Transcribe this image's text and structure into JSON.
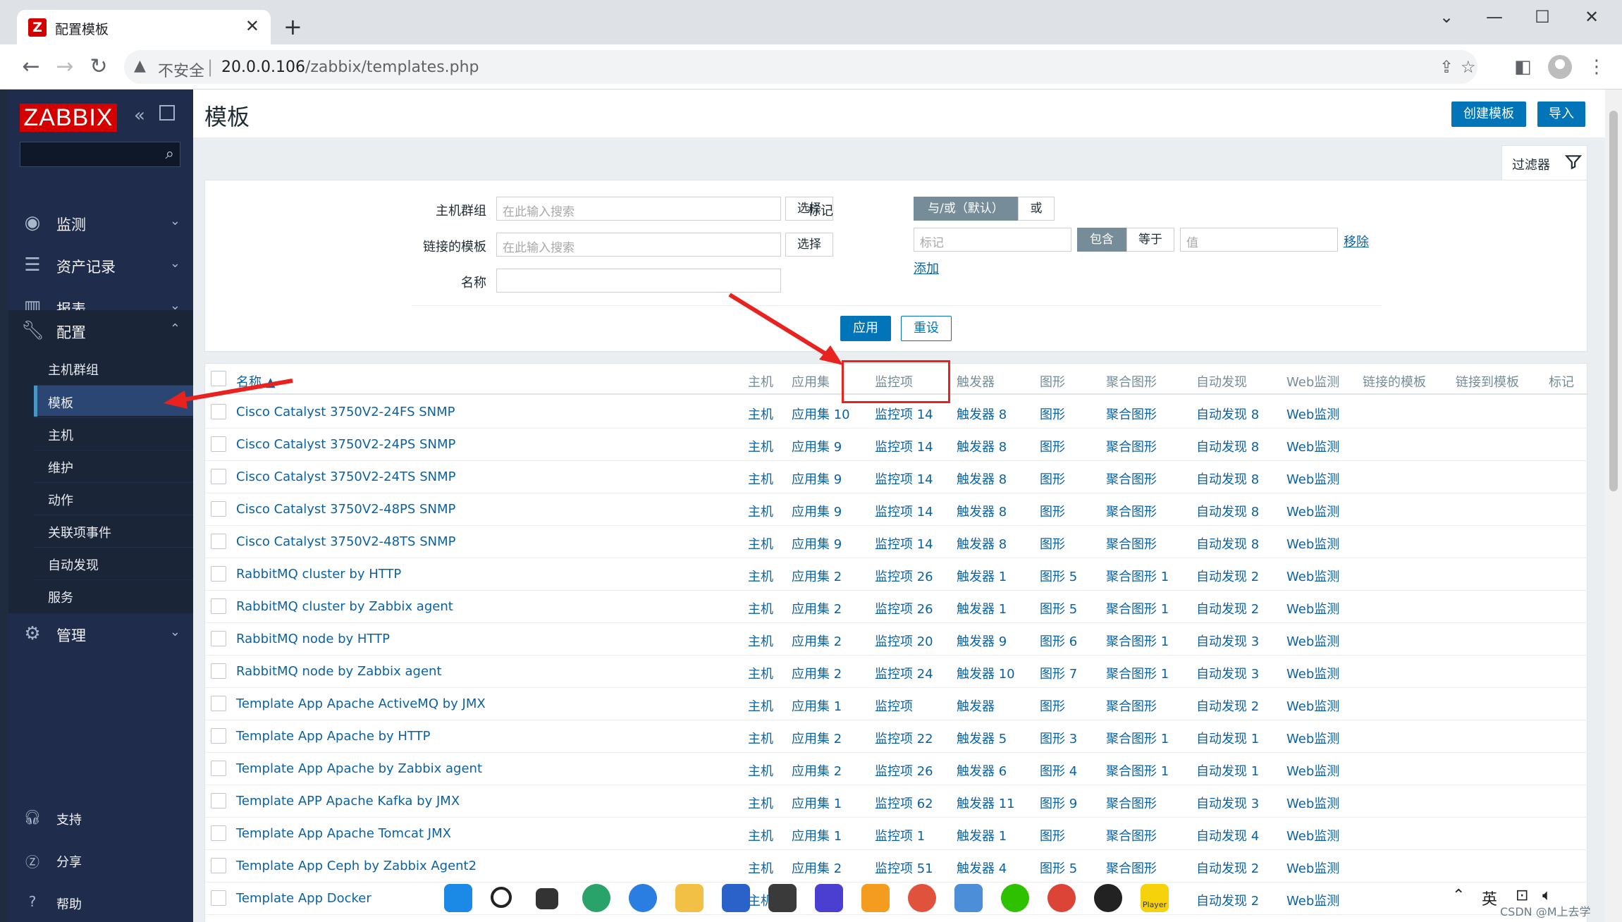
{
  "browser": {
    "tab_title": "配置模板",
    "tab_favicon": "Z",
    "insecure_label": "不安全",
    "url_host": "20.0.0.106",
    "url_path": "/zabbix/templates.php"
  },
  "sidebar": {
    "logo": "ZABBIX",
    "menu": [
      {
        "label": "监测",
        "icon": "eye-icon"
      },
      {
        "label": "资产记录",
        "icon": "list-icon"
      },
      {
        "label": "报表",
        "icon": "chart-icon"
      },
      {
        "label": "配置",
        "icon": "wrench-icon"
      },
      {
        "label": "管理",
        "icon": "gear-icon"
      }
    ],
    "config_submenu": [
      "主机群组",
      "模板",
      "主机",
      "维护",
      "动作",
      "关联项事件",
      "自动发现",
      "服务"
    ],
    "active_submenu": "模板",
    "bottom": [
      {
        "label": "支持",
        "icon": "headset-icon"
      },
      {
        "label": "分享",
        "icon": "share-icon"
      },
      {
        "label": "帮助",
        "icon": "help-icon"
      }
    ]
  },
  "page": {
    "title": "模板",
    "create_button": "创建模板",
    "import_button": "导入",
    "filter_tab": "过滤器"
  },
  "filter": {
    "host_group_label": "主机群组",
    "host_group_placeholder": "在此输入搜索",
    "linked_templates_label": "链接的模板",
    "linked_templates_placeholder": "在此输入搜索",
    "name_label": "名称",
    "name_value": "",
    "select_button": "选择",
    "tags_label": "标记",
    "tag_and_or": "与/或（默认）",
    "tag_or": "或",
    "tag_placeholder": "标记",
    "contains": "包含",
    "equals": "等于",
    "value_placeholder": "值",
    "remove_link": "移除",
    "add_link": "添加",
    "apply_button": "应用",
    "reset_button": "重设"
  },
  "table": {
    "headers": {
      "name": "名称 ▲",
      "hosts": "主机",
      "applications": "应用集",
      "items": "监控项",
      "triggers": "触发器",
      "graphs": "图形",
      "screens": "聚合图形",
      "discovery": "自动发现",
      "web": "Web监测",
      "linked_templates": "链接的模板",
      "linked_to": "链接到模板",
      "tags": "标记"
    },
    "rows": [
      {
        "name": "Cisco Catalyst 3750V2-24FS SNMP",
        "hosts": "主机",
        "apps": "应用集 10",
        "items": "监控项 14",
        "triggers": "触发器 8",
        "graphs": "图形",
        "screens": "聚合图形",
        "discovery": "自动发现 8",
        "web": "Web监测"
      },
      {
        "name": "Cisco Catalyst 3750V2-24PS SNMP",
        "hosts": "主机",
        "apps": "应用集 9",
        "items": "监控项 14",
        "triggers": "触发器 8",
        "graphs": "图形",
        "screens": "聚合图形",
        "discovery": "自动发现 8",
        "web": "Web监测"
      },
      {
        "name": "Cisco Catalyst 3750V2-24TS SNMP",
        "hosts": "主机",
        "apps": "应用集 9",
        "items": "监控项 14",
        "triggers": "触发器 8",
        "graphs": "图形",
        "screens": "聚合图形",
        "discovery": "自动发现 8",
        "web": "Web监测"
      },
      {
        "name": "Cisco Catalyst 3750V2-48PS SNMP",
        "hosts": "主机",
        "apps": "应用集 9",
        "items": "监控项 14",
        "triggers": "触发器 8",
        "graphs": "图形",
        "screens": "聚合图形",
        "discovery": "自动发现 8",
        "web": "Web监测"
      },
      {
        "name": "Cisco Catalyst 3750V2-48TS SNMP",
        "hosts": "主机",
        "apps": "应用集 9",
        "items": "监控项 14",
        "triggers": "触发器 8",
        "graphs": "图形",
        "screens": "聚合图形",
        "discovery": "自动发现 8",
        "web": "Web监测"
      },
      {
        "name": "RabbitMQ cluster by HTTP",
        "hosts": "主机",
        "apps": "应用集 2",
        "items": "监控项 26",
        "triggers": "触发器 1",
        "graphs": "图形 5",
        "screens": "聚合图形 1",
        "discovery": "自动发现 2",
        "web": "Web监测"
      },
      {
        "name": "RabbitMQ cluster by Zabbix agent",
        "hosts": "主机",
        "apps": "应用集 2",
        "items": "监控项 26",
        "triggers": "触发器 1",
        "graphs": "图形 5",
        "screens": "聚合图形 1",
        "discovery": "自动发现 2",
        "web": "Web监测"
      },
      {
        "name": "RabbitMQ node by HTTP",
        "hosts": "主机",
        "apps": "应用集 2",
        "items": "监控项 20",
        "triggers": "触发器 9",
        "graphs": "图形 6",
        "screens": "聚合图形 1",
        "discovery": "自动发现 3",
        "web": "Web监测"
      },
      {
        "name": "RabbitMQ node by Zabbix agent",
        "hosts": "主机",
        "apps": "应用集 2",
        "items": "监控项 24",
        "triggers": "触发器 10",
        "graphs": "图形 7",
        "screens": "聚合图形 1",
        "discovery": "自动发现 3",
        "web": "Web监测"
      },
      {
        "name": "Template App Apache ActiveMQ by JMX",
        "hosts": "主机",
        "apps": "应用集 1",
        "items": "监控项",
        "triggers": "触发器",
        "graphs": "图形",
        "screens": "聚合图形",
        "discovery": "自动发现 2",
        "web": "Web监测"
      },
      {
        "name": "Template App Apache by HTTP",
        "hosts": "主机",
        "apps": "应用集 2",
        "items": "监控项 22",
        "triggers": "触发器 5",
        "graphs": "图形 3",
        "screens": "聚合图形 1",
        "discovery": "自动发现 1",
        "web": "Web监测"
      },
      {
        "name": "Template App Apache by Zabbix agent",
        "hosts": "主机",
        "apps": "应用集 2",
        "items": "监控项 26",
        "triggers": "触发器 6",
        "graphs": "图形 4",
        "screens": "聚合图形 1",
        "discovery": "自动发现 1",
        "web": "Web监测"
      },
      {
        "name": "Template APP Apache Kafka by JMX",
        "hosts": "主机",
        "apps": "应用集 1",
        "items": "监控项 62",
        "triggers": "触发器 11",
        "graphs": "图形 9",
        "screens": "聚合图形",
        "discovery": "自动发现 3",
        "web": "Web监测"
      },
      {
        "name": "Template App Apache Tomcat JMX",
        "hosts": "主机",
        "apps": "应用集 1",
        "items": "监控项 1",
        "triggers": "触发器 1",
        "graphs": "图形",
        "screens": "聚合图形",
        "discovery": "自动发现 4",
        "web": "Web监测"
      },
      {
        "name": "Template App Ceph by Zabbix Agent2",
        "hosts": "主机",
        "apps": "应用集 2",
        "items": "监控项 51",
        "triggers": "触发器 4",
        "graphs": "图形 5",
        "screens": "聚合图形",
        "discovery": "自动发现 2",
        "web": "Web监测"
      },
      {
        "name": "Template App Docker",
        "hosts": "主机",
        "apps": "",
        "items": "",
        "triggers": "",
        "graphs": "",
        "screens": "",
        "discovery": "自动发现 2",
        "web": "Web监测"
      }
    ]
  },
  "overlay": {
    "ime_label": "英",
    "watermark": "CSDN @M上去学",
    "player_label": "Player"
  },
  "colors": {
    "sidebar_bg": "#1f2c4c",
    "brand_red": "#d40000",
    "link_blue": "#0a62a3",
    "button_blue": "#0275b8",
    "annotation_red": "#e8231f"
  }
}
